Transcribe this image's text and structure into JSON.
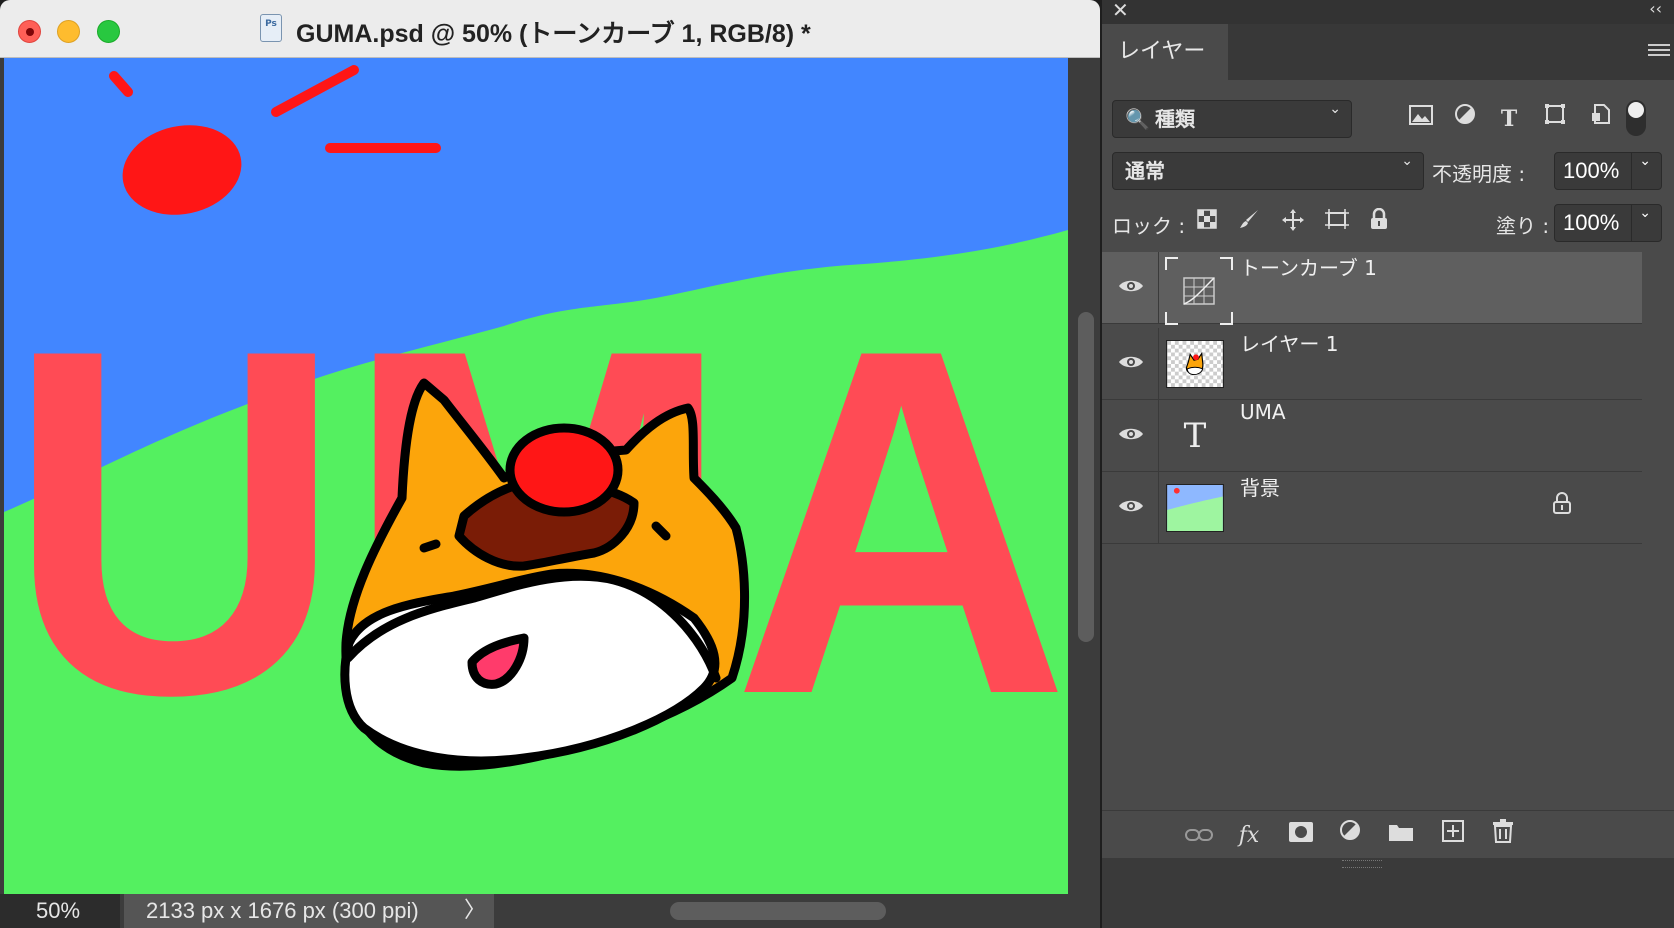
{
  "document": {
    "title": "GUMA.psd @ 50% (トーンカーブ 1, RGB/8) *",
    "ps_icon": "Ps",
    "canvas": {
      "text": "UMA",
      "sky_color": "#4286ff",
      "grass_color": "#54f060",
      "text_color": "#ff4b55",
      "sun_color": "#ff1616"
    },
    "status": {
      "zoom": "50%",
      "info": "2133 px x 1676 px (300 ppi)",
      "chevron": "〉"
    }
  },
  "panel": {
    "close_glyph": "✕",
    "collapse_glyph": "‹‹",
    "tab": "レイヤー",
    "filter": {
      "icon": "🔍",
      "label": "種類",
      "dropdown": "⌄",
      "icons": [
        "image-filter-icon",
        "adjustment-filter-icon",
        "type-filter-icon",
        "shape-filter-icon",
        "smart-object-filter-icon"
      ]
    },
    "blend": {
      "mode": "通常",
      "opacity_label": "不透明度 :",
      "opacity_value": "100%"
    },
    "lock": {
      "label": "ロック :",
      "fill_label": "塗り :",
      "fill_value": "100%"
    },
    "layers": [
      {
        "name": "トーンカーブ 1",
        "type": "adjustment",
        "selected": true
      },
      {
        "name": "レイヤー 1",
        "type": "pixel",
        "selected": false
      },
      {
        "name": "UMA",
        "type": "text",
        "selected": false
      },
      {
        "name": "背景",
        "type": "background",
        "selected": false,
        "locked": true
      }
    ],
    "bottom_icons": [
      "link-icon",
      "fx-icon",
      "mask-icon",
      "adjustment-icon",
      "folder-icon",
      "new-layer-icon",
      "trash-icon"
    ],
    "fx_label": "fx"
  }
}
